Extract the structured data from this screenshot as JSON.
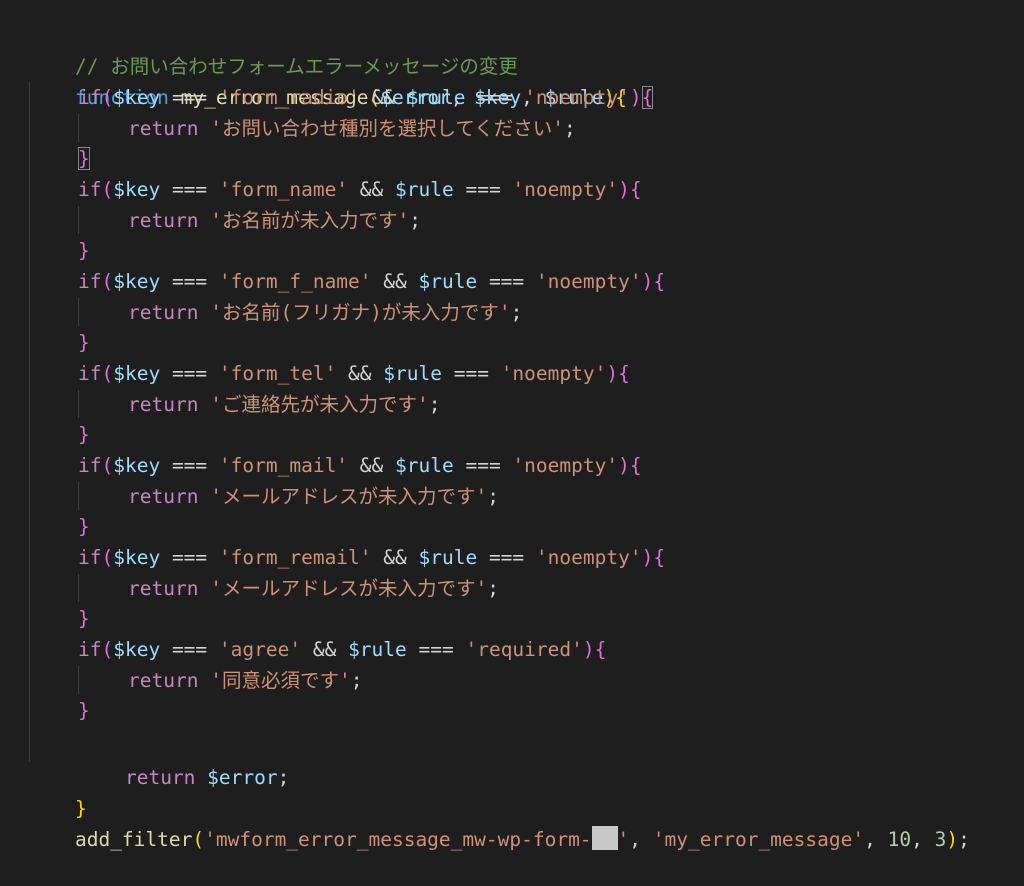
{
  "comment": "// お問い合わせフォームエラーメッセージの変更",
  "function_decl": {
    "keyword": "function",
    "name": "my_error_message",
    "open_paren": "(",
    "param1": "$error",
    "sep1": ", ",
    "param2": "$key",
    "sep2": ", ",
    "param3": "$rule",
    "close_paren": ")",
    "open_brace": "{"
  },
  "rules": [
    {
      "key": "'form_radio'",
      "rule": "'noempty'",
      "message": "'お問い合わせ種別を選択してください'"
    },
    {
      "key": "'form_name'",
      "rule": "'noempty'",
      "message": "'お名前が未入力です'"
    },
    {
      "key": "'form_f_name'",
      "rule": "'noempty'",
      "message": "'お名前(フリガナ)が未入力です'"
    },
    {
      "key": "'form_tel'",
      "rule": "'noempty'",
      "message": "'ご連絡先が未入力です'"
    },
    {
      "key": "'form_mail'",
      "rule": "'noempty'",
      "message": "'メールアドレスが未入力です'"
    },
    {
      "key": "'form_remail'",
      "rule": "'noempty'",
      "message": "'メールアドレスが未入力です'"
    },
    {
      "key": "'agree'",
      "rule": "'required'",
      "message": "'同意必須です'"
    }
  ],
  "tokens": {
    "if": "if",
    "open_paren": "(",
    "key_var": "$key",
    "rule_var": "$rule",
    "strict_eq": " === ",
    "and_op": " && ",
    "close_paren": ")",
    "open_brace": "{",
    "close_brace": "}",
    "return_kw": "return",
    "semicolon": ";",
    "error_var": "$error"
  },
  "function_close": "}",
  "add_filter": {
    "name": "add_filter",
    "open_paren": "(",
    "hook_prefix": "'mwform_error_message_mw-wp-form-",
    "hook_suffix": "'",
    "sep1": ", ",
    "callback": "'my_error_message'",
    "sep2": ", ",
    "priority": "10",
    "sep3": ", ",
    "args": "3",
    "close_paren": ")",
    "semicolon": ";"
  }
}
